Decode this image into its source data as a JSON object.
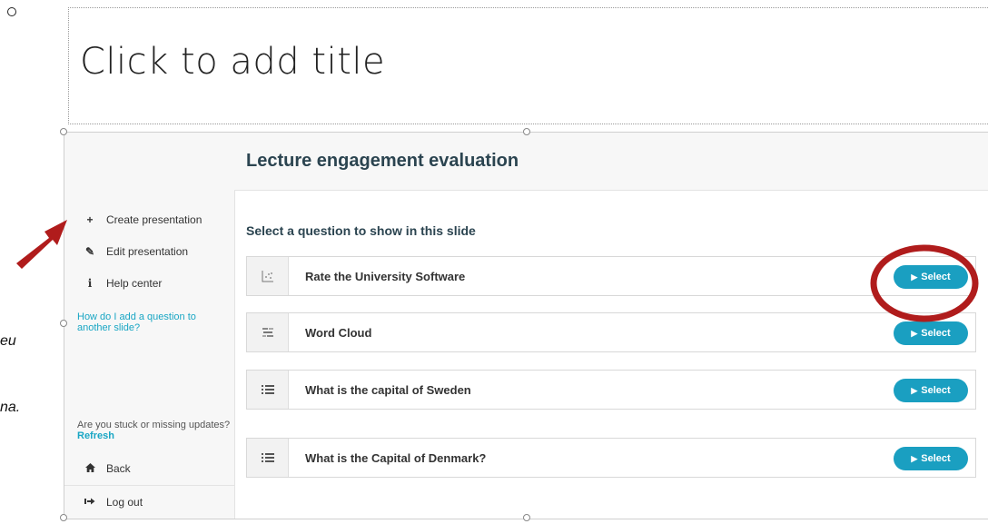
{
  "slide": {
    "title_placeholder": "Click to add title",
    "side_text_1": "eu",
    "side_text_2": "na."
  },
  "app": {
    "header_title": "Lecture engagement evaluation",
    "sidebar": {
      "items": [
        {
          "icon": "plus-icon",
          "glyph": "+",
          "label": "Create presentation"
        },
        {
          "icon": "edit-icon",
          "glyph": "✎",
          "label": "Edit presentation"
        },
        {
          "icon": "info-icon",
          "glyph": "i",
          "label": "Help center"
        }
      ],
      "help_link": "How do I add a question to another slide?",
      "stuck_text": "Are you stuck or missing updates?",
      "refresh_label": "Refresh",
      "back_label": "Back",
      "logout_label": "Log out"
    },
    "main": {
      "prompt": "Select a question to show in this slide",
      "select_label": "Select",
      "questions": [
        {
          "icon": "scale-icon",
          "title": "Rate the University Software"
        },
        {
          "icon": "word-cloud-icon",
          "title": "Word Cloud"
        },
        {
          "icon": "list-icon",
          "title": "What is the capital of Sweden"
        },
        {
          "icon": "list-icon",
          "title": "What is the Capital of Denmark?"
        }
      ]
    }
  },
  "colors": {
    "accent": "#1a9fc1",
    "annotation": "#b01c1c",
    "heading": "#2b4450"
  }
}
